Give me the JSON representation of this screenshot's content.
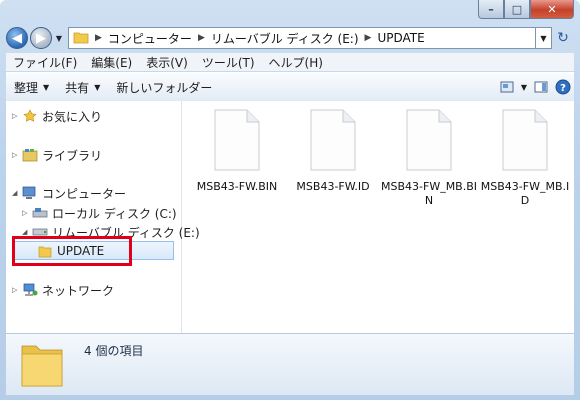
{
  "caption": {
    "minimize_glyph": "–",
    "maximize_glyph": "□",
    "close_glyph": "✕"
  },
  "address": {
    "back_glyph": "◀",
    "forward_glyph": "▶",
    "crumbs": [
      "コンピューター",
      "リムーバブル ディスク (E:)",
      "UPDATE"
    ],
    "refresh_glyph": "↻"
  },
  "menu": [
    "ファイル(F)",
    "編集(E)",
    "表示(V)",
    "ツール(T)",
    "ヘルプ(H)"
  ],
  "toolbar": {
    "organize": "整理",
    "share": "共有",
    "new_folder": "新しいフォルダー"
  },
  "tree": {
    "favorites": "お気に入り",
    "libraries": "ライブラリ",
    "computer": "コンピューター",
    "local_disk": "ローカル ディスク (C:)",
    "removable": "リムーバブル ディスク (E:)",
    "update": "UPDATE",
    "network": "ネットワーク"
  },
  "files": [
    {
      "name": "MSB43-FW.BIN"
    },
    {
      "name": "MSB43-FW.ID"
    },
    {
      "name": "MSB43-FW_MB.BIN"
    },
    {
      "name": "MSB43-FW_MB.ID"
    }
  ],
  "details": {
    "item_count_text": "4 個の項目"
  },
  "colors": {
    "highlight": "#e0001b",
    "folder": "#f2c94c",
    "titlebar": "#bcd3ec"
  }
}
